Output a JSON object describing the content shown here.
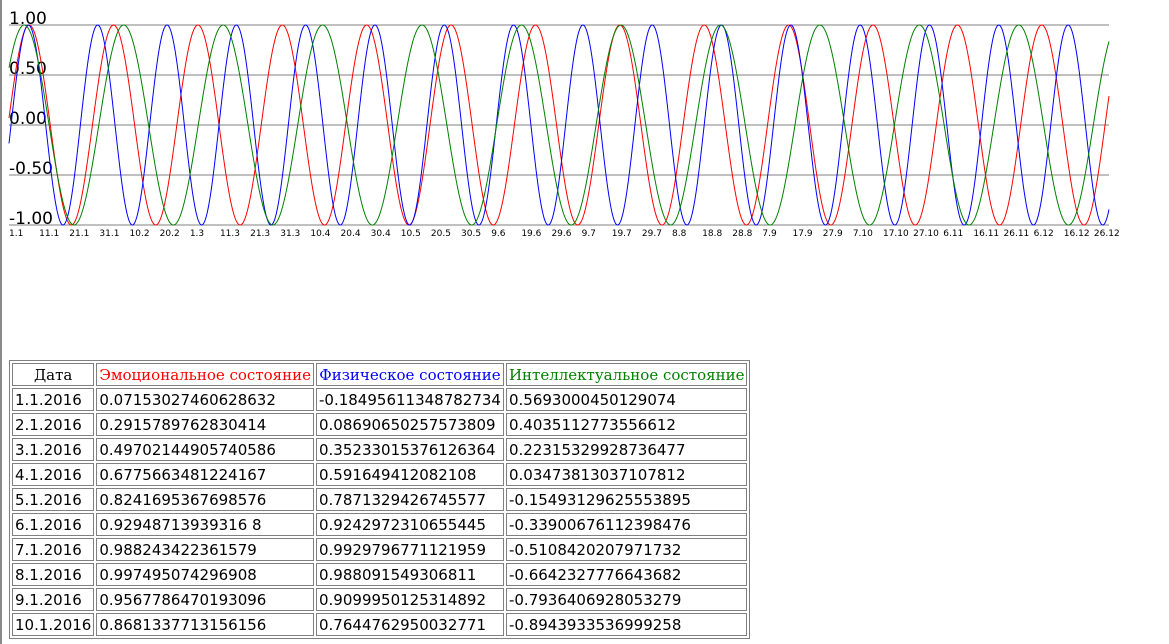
{
  "colors": {
    "emotional": "#ff0000",
    "physical": "#0000ff",
    "intellectual": "#008000",
    "gridline": "#808080"
  },
  "chart_data": {
    "type": "line",
    "ylim": [
      -1,
      1
    ],
    "yticks": [
      "1.00",
      "0.50",
      "0.00",
      "-0.50",
      "-1.00"
    ],
    "x_start": "1.1.2016",
    "x_end": "31.12.2016",
    "xtick_labels": [
      {
        "label": "1.1",
        "date": "2016-01-01"
      },
      {
        "label": "11.1",
        "date": "2016-01-11"
      },
      {
        "label": "21.1",
        "date": "2016-01-21"
      },
      {
        "label": "31.1",
        "date": "2016-01-31"
      },
      {
        "label": "10.2",
        "date": "2016-02-10"
      },
      {
        "label": "20.2",
        "date": "2016-02-20"
      },
      {
        "label": "1.3",
        "date": "2016-03-01"
      },
      {
        "label": "11.3",
        "date": "2016-03-11"
      },
      {
        "label": "21.3",
        "date": "2016-03-21"
      },
      {
        "label": "31.3",
        "date": "2016-03-31"
      },
      {
        "label": "10.4",
        "date": "2016-04-10"
      },
      {
        "label": "20.4",
        "date": "2016-04-20"
      },
      {
        "label": "30.4",
        "date": "2016-04-30"
      },
      {
        "label": "10.5",
        "date": "2016-05-10"
      },
      {
        "label": "20.5",
        "date": "2016-05-20"
      },
      {
        "label": "30.5",
        "date": "2016-05-30"
      },
      {
        "label": "9.6",
        "date": "2016-06-09"
      },
      {
        "label": "19.6",
        "date": "2016-06-19"
      },
      {
        "label": "29.6",
        "date": "2016-06-29"
      },
      {
        "label": "9.7",
        "date": "2016-07-09"
      },
      {
        "label": "19.7",
        "date": "2016-07-19"
      },
      {
        "label": "29.7",
        "date": "2016-07-29"
      },
      {
        "label": "8.8",
        "date": "2016-08-08"
      },
      {
        "label": "18.8",
        "date": "2016-08-18"
      },
      {
        "label": "28.8",
        "date": "2016-08-28"
      },
      {
        "label": "7.9",
        "date": "2016-09-07"
      },
      {
        "label": "17.9",
        "date": "2016-09-17"
      },
      {
        "label": "27.9",
        "date": "2016-09-27"
      },
      {
        "label": "7.10",
        "date": "2016-10-07"
      },
      {
        "label": "17.10",
        "date": "2016-10-17"
      },
      {
        "label": "27.10",
        "date": "2016-10-27"
      },
      {
        "label": "6.11",
        "date": "2016-11-06"
      },
      {
        "label": "16.11",
        "date": "2016-11-16"
      },
      {
        "label": "26.11",
        "date": "2016-11-26"
      },
      {
        "label": "6.12",
        "date": "2016-12-06"
      },
      {
        "label": "16.12",
        "date": "2016-12-16"
      },
      {
        "label": "26.12",
        "date": "2016-12-26"
      }
    ],
    "series": [
      {
        "key": "emotional",
        "period_days": 28,
        "phase_days": 0.31,
        "color": "#ff0000",
        "sample_dates": [
          "2016-01-01",
          "2016-01-02",
          "2016-01-03",
          "2016-01-04",
          "2016-01-05",
          "2016-01-06",
          "2016-01-07",
          "2016-01-08",
          "2016-01-09",
          "2016-01-10"
        ],
        "sample_values": [
          0.0715302746062863,
          0.2915789762830414,
          0.4970214490574059,
          0.6775663481224167,
          0.8241695367698576,
          0.929487139393168,
          0.988243422361579,
          0.997495074296908,
          0.9567786470193096,
          0.8681337713156156
        ]
      },
      {
        "key": "physical",
        "period_days": 23,
        "phase_days": -0.68,
        "color": "#0000ff",
        "sample_dates": [
          "2016-01-01",
          "2016-01-02",
          "2016-01-03",
          "2016-01-04",
          "2016-01-05",
          "2016-01-06",
          "2016-01-07",
          "2016-01-08",
          "2016-01-09",
          "2016-01-10"
        ],
        "sample_values": [
          -0.1849561134878273,
          0.0869065025757381,
          0.3523301537612636,
          0.591649412082108,
          0.7871329426745577,
          0.9242972310655445,
          0.9929796771121959,
          0.988091549306811,
          0.9099950125314892,
          0.7644762950032771
        ]
      },
      {
        "key": "intellectual",
        "period_days": 33,
        "phase_days": 3.2,
        "color": "#008000",
        "sample_dates": [
          "2016-01-01",
          "2016-01-02",
          "2016-01-03",
          "2016-01-04",
          "2016-01-05",
          "2016-01-06",
          "2016-01-07",
          "2016-01-08",
          "2016-01-09",
          "2016-01-10"
        ],
        "sample_values": [
          0.5693000450129074,
          0.4035112773556612,
          0.2231532992873648,
          0.0347381303710781,
          -0.154931296255539,
          -0.3390067611239848,
          -0.5108420207971732,
          -0.6642327776643682,
          -0.7936406928053279,
          -0.8943933536999258
        ]
      }
    ]
  },
  "table": {
    "headers": [
      "Дата",
      "Эмоциональное состояние",
      "Физическое состояние",
      "Интеллектуальное состояние"
    ],
    "rows": [
      [
        "1.1.2016",
        "0.07153027460628632",
        "-0.18495611348782734",
        "0.5693000450129074"
      ],
      [
        "2.1.2016",
        "0.2915789762830414",
        "0.08690650257573809",
        "0.4035112773556612"
      ],
      [
        "3.1.2016",
        "0.49702144905740586",
        "0.35233015376126364",
        "0.22315329928736477"
      ],
      [
        "4.1.2016",
        "0.6775663481224167",
        "0.591649412082108",
        "0.03473813037107812"
      ],
      [
        "5.1.2016",
        "0.8241695367698576",
        "0.7871329426745577",
        "-0.15493129625553895"
      ],
      [
        "6.1.2016",
        "0.92948713939316 8",
        "0.9242972310655445",
        "-0.33900676112398476"
      ],
      [
        "7.1.2016",
        "0.988243422361579",
        "0.9929796771121959",
        "-0.5108420207971732"
      ],
      [
        "8.1.2016",
        "0.997495074296908",
        "0.988091549306811",
        "-0.6642327776643682"
      ],
      [
        "9.1.2016",
        "0.9567786470193096",
        "0.9099950125314892",
        "-0.7936406928053279"
      ],
      [
        "10.1.2016",
        "0.8681337713156156",
        "0.7644762950032771",
        "-0.8943933536999258"
      ]
    ]
  }
}
